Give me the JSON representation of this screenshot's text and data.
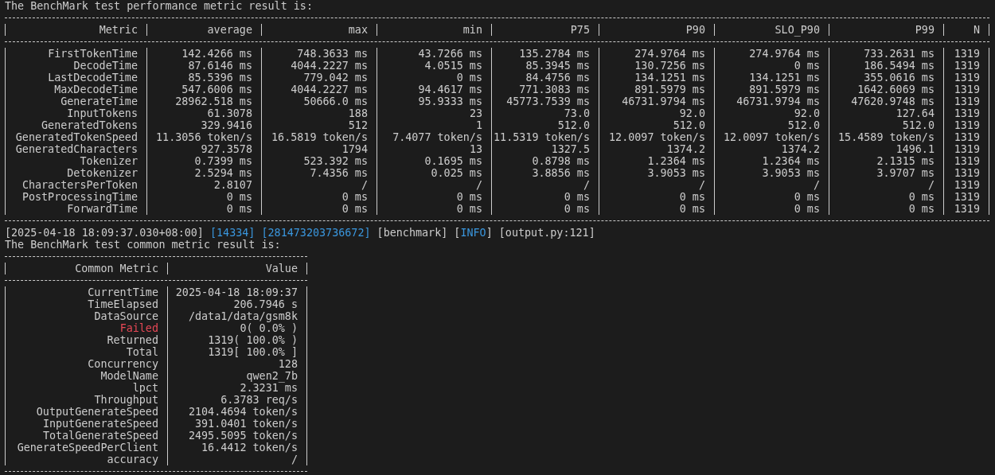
{
  "performance_title": "The BenchMark test performance metric result is:",
  "performance_table": {
    "columns": [
      "Metric",
      "average",
      "max",
      "min",
      "P75",
      "P90",
      "SLO_P90",
      "P99",
      "N"
    ],
    "rows": [
      [
        "FirstTokenTime",
        "142.4266 ms",
        "748.3633 ms",
        "43.7266 ms",
        "135.2784 ms",
        "274.9764 ms",
        "274.9764 ms",
        "733.2631 ms",
        "1319"
      ],
      [
        "DecodeTime",
        "87.6146 ms",
        "4044.2227 ms",
        "4.0515 ms",
        "85.3945 ms",
        "130.7256 ms",
        "0 ms",
        "186.5494 ms",
        "1319"
      ],
      [
        "LastDecodeTime",
        "85.5396 ms",
        "779.042 ms",
        "0 ms",
        "84.4756 ms",
        "134.1251 ms",
        "134.1251 ms",
        "355.0616 ms",
        "1319"
      ],
      [
        "MaxDecodeTime",
        "547.6006 ms",
        "4044.2227 ms",
        "94.4617 ms",
        "771.3083 ms",
        "891.5979 ms",
        "891.5979 ms",
        "1642.6069 ms",
        "1319"
      ],
      [
        "GenerateTime",
        "28962.518 ms",
        "50666.0 ms",
        "95.9333 ms",
        "45773.7539 ms",
        "46731.9794 ms",
        "46731.9794 ms",
        "47620.9748 ms",
        "1319"
      ],
      [
        "InputTokens",
        "61.3078",
        "188",
        "23",
        "73.0",
        "92.0",
        "92.0",
        "127.64",
        "1319"
      ],
      [
        "GeneratedTokens",
        "329.9416",
        "512",
        "1",
        "512.0",
        "512.0",
        "512.0",
        "512.0",
        "1319"
      ],
      [
        "GeneratedTokenSpeed",
        "11.3056 token/s",
        "16.5819 token/s",
        "7.4077 token/s",
        "11.5319 token/s",
        "12.0097 token/s",
        "12.0097 token/s",
        "15.4589 token/s",
        "1319"
      ],
      [
        "GeneratedCharacters",
        "927.3578",
        "1794",
        "13",
        "1327.5",
        "1374.2",
        "1374.2",
        "1496.1",
        "1319"
      ],
      [
        "Tokenizer",
        "0.7399 ms",
        "523.392 ms",
        "0.1695 ms",
        "0.8798 ms",
        "1.2364 ms",
        "1.2364 ms",
        "2.1315 ms",
        "1319"
      ],
      [
        "Detokenizer",
        "2.5294 ms",
        "7.4356 ms",
        "0.025 ms",
        "3.8856 ms",
        "3.9053 ms",
        "3.9053 ms",
        "3.9707 ms",
        "1319"
      ],
      [
        "CharactersPerToken",
        "2.8107",
        "/",
        "/",
        "/",
        "/",
        "/",
        "/",
        "1319"
      ],
      [
        "PostProcessingTime",
        "0 ms",
        "0 ms",
        "0 ms",
        "0 ms",
        "0 ms",
        "0 ms",
        "0 ms",
        "1319"
      ],
      [
        "ForwardTime",
        "0 ms",
        "0 ms",
        "0 ms",
        "0 ms",
        "0 ms",
        "0 ms",
        "0 ms",
        "1319"
      ]
    ]
  },
  "log_line": [
    {
      "parts": [
        {
          "text": "[2025-04-18 18:09:37.030+08:00]",
          "color": "#cccccc"
        }
      ]
    },
    {
      "parts": [
        {
          "text": "[14334]",
          "color": "#3a96dd"
        }
      ]
    },
    {
      "parts": [
        {
          "text": "[281473203736672]",
          "color": "#3a96dd"
        }
      ]
    },
    {
      "parts": [
        {
          "text": "[benchmark]",
          "color": "#cccccc"
        }
      ]
    },
    {
      "parts": [
        {
          "text": "[",
          "color": "#cccccc"
        },
        {
          "text": "INFO",
          "color": "#3a96dd"
        },
        {
          "text": "]",
          "color": "#cccccc"
        }
      ]
    },
    {
      "parts": [
        {
          "text": "[output.py:121]",
          "color": "#cccccc"
        }
      ]
    }
  ],
  "common_title": "The BenchMark test common metric result is:",
  "common_table": {
    "columns": [
      "Common Metric",
      "Value"
    ],
    "rows": [
      {
        "metric": "CurrentTime",
        "value": "2025-04-18 18:09:37",
        "color": "#cccccc"
      },
      {
        "metric": "TimeElapsed",
        "value": "206.7946 s",
        "color": "#cccccc"
      },
      {
        "metric": "DataSource",
        "value": "/data1/data/gsm8k",
        "color": "#cccccc"
      },
      {
        "metric": "Failed",
        "value": "0( 0.0% )",
        "color": "#e74856"
      },
      {
        "metric": "Returned",
        "value": "1319( 100.0% )",
        "color": "#cccccc"
      },
      {
        "metric": "Total",
        "value": "1319[ 100.0% ]",
        "color": "#cccccc"
      },
      {
        "metric": "Concurrency",
        "value": "128",
        "color": "#cccccc"
      },
      {
        "metric": "ModelName",
        "value": "qwen2_7b",
        "color": "#cccccc"
      },
      {
        "metric": "lpct",
        "value": "2.3231 ms",
        "color": "#cccccc"
      },
      {
        "metric": "Throughput",
        "value": "6.3783 req/s",
        "color": "#cccccc"
      },
      {
        "metric": "OutputGenerateSpeed",
        "value": "2104.4694 token/s",
        "color": "#cccccc"
      },
      {
        "metric": "InputGenerateSpeed",
        "value": "391.0401 token/s",
        "color": "#cccccc"
      },
      {
        "metric": "TotalGenerateSpeed",
        "value": "2495.5095 token/s",
        "color": "#cccccc"
      },
      {
        "metric": "GenerateSpeedPerClient",
        "value": "16.4412 token/s",
        "color": "#cccccc"
      },
      {
        "metric": "accuracy",
        "value": "/",
        "color": "#cccccc"
      }
    ]
  }
}
